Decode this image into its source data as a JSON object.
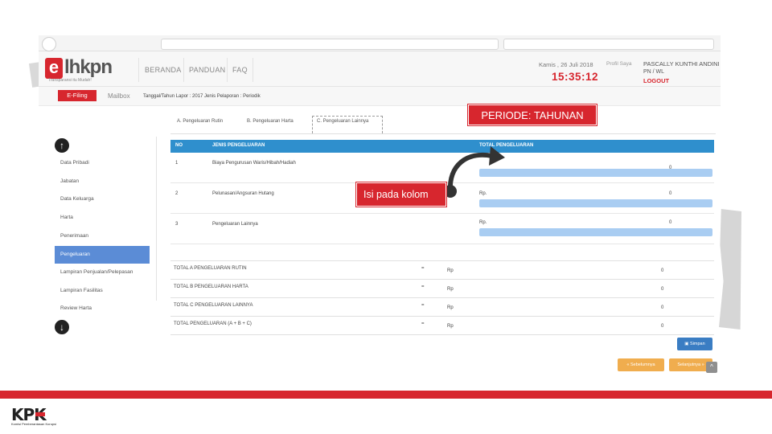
{
  "header": {
    "logo_letter": "e",
    "logo_text": "lhkpn",
    "logo_tagline": "Transparansi itu Mudah!",
    "nav": [
      "BERANDA",
      "PANDUAN",
      "FAQ"
    ],
    "date": "Kamis , 26 Juli 2018",
    "clock": "15:35:12",
    "profil_label": "Profil Saya",
    "user_name": "PASCALLY KUNTHI ANDINI",
    "user_role": "PN / WL",
    "logout_label": "LOGOUT"
  },
  "menu": {
    "efiling_label": "E-Filing",
    "mailbox_label": "Mailbox",
    "report_info": "Tanggal/Tahun Lapor : 2017   Jenis Pelaporan : Periodik"
  },
  "periode_label": "PERIODE: TAHUNAN",
  "tabs": [
    "A. Pengeluaran Rutin",
    "B. Pengeluaran Harta",
    "C. Pengeluaran Lainnya"
  ],
  "sidebar": {
    "items": [
      "Data Pribadi",
      "Jabatan",
      "Data Keluarga",
      "Harta",
      "Penerimaan",
      "Pengeluaran",
      "Lampiran Penjualan/Pelepasan",
      "Lampiran Fasilitas",
      "Review Harta"
    ],
    "active_index": 5
  },
  "table": {
    "headers": [
      "NO",
      "JENIS PENGELUARAN",
      "TOTAL PENGELUARAN"
    ],
    "rows": [
      {
        "no": "1",
        "name": "Biaya Pengurusan Waris/Hibah/Hadiah",
        "rp": "",
        "value": "0"
      },
      {
        "no": "2",
        "name": "Pelunasan/Angsuran Hutang",
        "rp": "Rp.",
        "value": "0"
      },
      {
        "no": "3",
        "name": "Pengeluaran Lainnya",
        "rp": "Rp.",
        "value": "0"
      }
    ]
  },
  "totals": [
    {
      "label": "TOTAL A PENGELUARAN RUTIN",
      "eq": "=",
      "rp": "Rp",
      "value": "0"
    },
    {
      "label": "TOTAL B PENGELUARAN HARTA",
      "eq": "=",
      "rp": "Rp",
      "value": "0"
    },
    {
      "label": "TOTAL C PENGELUARAN LAINNYA",
      "eq": "=",
      "rp": "Rp",
      "value": "0"
    },
    {
      "label": "TOTAL PENGELUARAN (A + B + C)",
      "eq": "=",
      "rp": "Rp",
      "value": "0"
    }
  ],
  "buttons": {
    "simpan": "Simpan",
    "sebelumnya": "Sebelumnya",
    "selanjutnya": "Selanjutnya",
    "scroll_top": "^"
  },
  "callout_label": "Isi pada kolom",
  "footer": {
    "kpk_text": "KPK",
    "kpk_subtitle": "Komisi Pemberantasan Korupsi"
  },
  "colors": {
    "brand_red": "#d7262e",
    "header_blue": "#2f8fcd",
    "input_blue": "#a9cdf2",
    "active_blue": "#5b8cd6",
    "orange": "#f0ad4e"
  }
}
